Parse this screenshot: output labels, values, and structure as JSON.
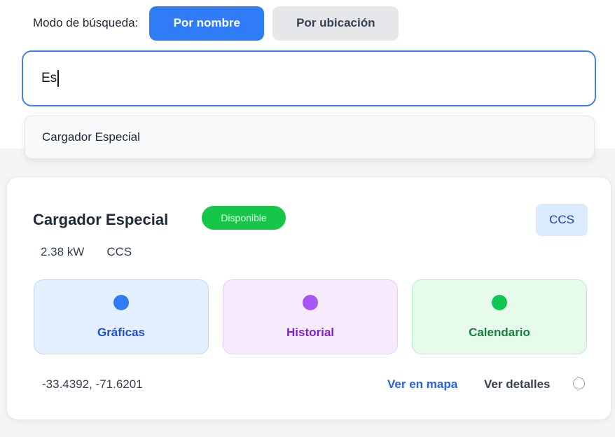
{
  "search_mode": {
    "label": "Modo de búsqueda:",
    "options": [
      {
        "label": "Por nombre",
        "active": true
      },
      {
        "label": "Por ubicación",
        "active": false
      }
    ]
  },
  "search": {
    "value": "Es"
  },
  "suggestions": [
    {
      "label": "Cargador Especial"
    }
  ],
  "charger": {
    "name": "Cargador Especial",
    "status": "Disponible",
    "connector_tag": "CCS",
    "power": "2.38 kW",
    "connector": "CCS",
    "actions": [
      {
        "label": "Gráficas",
        "color": "#2f7cf6"
      },
      {
        "label": "Historial",
        "color": "#a855f7"
      },
      {
        "label": "Calendario",
        "color": "#10c650"
      }
    ],
    "coordinates": "-33.4392, -71.6201",
    "map_link": "Ver en mapa",
    "details_link": "Ver detalles"
  },
  "colors": {
    "accent": "#2f7cf6",
    "status_available": "#16c649"
  }
}
